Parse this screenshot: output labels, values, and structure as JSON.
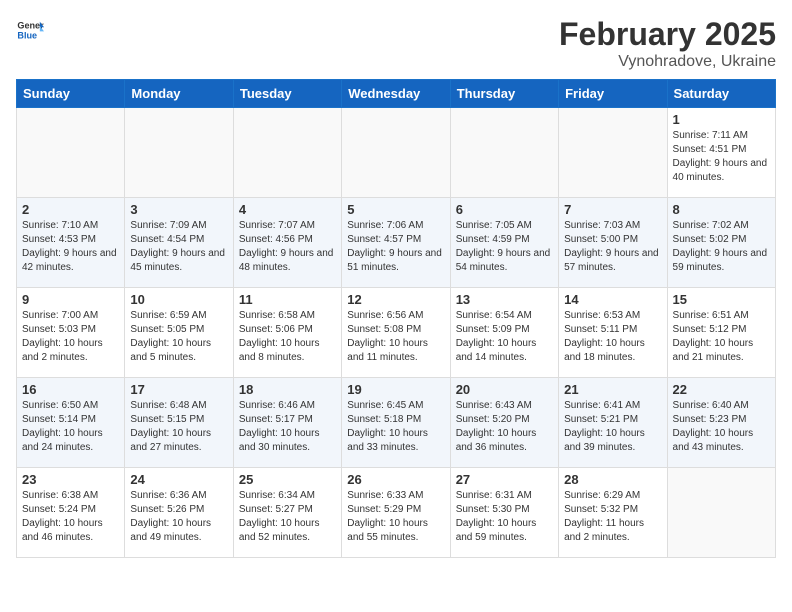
{
  "header": {
    "logo_general": "General",
    "logo_blue": "Blue",
    "month": "February 2025",
    "location": "Vynohradove, Ukraine"
  },
  "weekdays": [
    "Sunday",
    "Monday",
    "Tuesday",
    "Wednesday",
    "Thursday",
    "Friday",
    "Saturday"
  ],
  "weeks": [
    [
      {
        "day": "",
        "info": ""
      },
      {
        "day": "",
        "info": ""
      },
      {
        "day": "",
        "info": ""
      },
      {
        "day": "",
        "info": ""
      },
      {
        "day": "",
        "info": ""
      },
      {
        "day": "",
        "info": ""
      },
      {
        "day": "1",
        "info": "Sunrise: 7:11 AM\nSunset: 4:51 PM\nDaylight: 9 hours and 40 minutes."
      }
    ],
    [
      {
        "day": "2",
        "info": "Sunrise: 7:10 AM\nSunset: 4:53 PM\nDaylight: 9 hours and 42 minutes."
      },
      {
        "day": "3",
        "info": "Sunrise: 7:09 AM\nSunset: 4:54 PM\nDaylight: 9 hours and 45 minutes."
      },
      {
        "day": "4",
        "info": "Sunrise: 7:07 AM\nSunset: 4:56 PM\nDaylight: 9 hours and 48 minutes."
      },
      {
        "day": "5",
        "info": "Sunrise: 7:06 AM\nSunset: 4:57 PM\nDaylight: 9 hours and 51 minutes."
      },
      {
        "day": "6",
        "info": "Sunrise: 7:05 AM\nSunset: 4:59 PM\nDaylight: 9 hours and 54 minutes."
      },
      {
        "day": "7",
        "info": "Sunrise: 7:03 AM\nSunset: 5:00 PM\nDaylight: 9 hours and 57 minutes."
      },
      {
        "day": "8",
        "info": "Sunrise: 7:02 AM\nSunset: 5:02 PM\nDaylight: 9 hours and 59 minutes."
      }
    ],
    [
      {
        "day": "9",
        "info": "Sunrise: 7:00 AM\nSunset: 5:03 PM\nDaylight: 10 hours and 2 minutes."
      },
      {
        "day": "10",
        "info": "Sunrise: 6:59 AM\nSunset: 5:05 PM\nDaylight: 10 hours and 5 minutes."
      },
      {
        "day": "11",
        "info": "Sunrise: 6:58 AM\nSunset: 5:06 PM\nDaylight: 10 hours and 8 minutes."
      },
      {
        "day": "12",
        "info": "Sunrise: 6:56 AM\nSunset: 5:08 PM\nDaylight: 10 hours and 11 minutes."
      },
      {
        "day": "13",
        "info": "Sunrise: 6:54 AM\nSunset: 5:09 PM\nDaylight: 10 hours and 14 minutes."
      },
      {
        "day": "14",
        "info": "Sunrise: 6:53 AM\nSunset: 5:11 PM\nDaylight: 10 hours and 18 minutes."
      },
      {
        "day": "15",
        "info": "Sunrise: 6:51 AM\nSunset: 5:12 PM\nDaylight: 10 hours and 21 minutes."
      }
    ],
    [
      {
        "day": "16",
        "info": "Sunrise: 6:50 AM\nSunset: 5:14 PM\nDaylight: 10 hours and 24 minutes."
      },
      {
        "day": "17",
        "info": "Sunrise: 6:48 AM\nSunset: 5:15 PM\nDaylight: 10 hours and 27 minutes."
      },
      {
        "day": "18",
        "info": "Sunrise: 6:46 AM\nSunset: 5:17 PM\nDaylight: 10 hours and 30 minutes."
      },
      {
        "day": "19",
        "info": "Sunrise: 6:45 AM\nSunset: 5:18 PM\nDaylight: 10 hours and 33 minutes."
      },
      {
        "day": "20",
        "info": "Sunrise: 6:43 AM\nSunset: 5:20 PM\nDaylight: 10 hours and 36 minutes."
      },
      {
        "day": "21",
        "info": "Sunrise: 6:41 AM\nSunset: 5:21 PM\nDaylight: 10 hours and 39 minutes."
      },
      {
        "day": "22",
        "info": "Sunrise: 6:40 AM\nSunset: 5:23 PM\nDaylight: 10 hours and 43 minutes."
      }
    ],
    [
      {
        "day": "23",
        "info": "Sunrise: 6:38 AM\nSunset: 5:24 PM\nDaylight: 10 hours and 46 minutes."
      },
      {
        "day": "24",
        "info": "Sunrise: 6:36 AM\nSunset: 5:26 PM\nDaylight: 10 hours and 49 minutes."
      },
      {
        "day": "25",
        "info": "Sunrise: 6:34 AM\nSunset: 5:27 PM\nDaylight: 10 hours and 52 minutes."
      },
      {
        "day": "26",
        "info": "Sunrise: 6:33 AM\nSunset: 5:29 PM\nDaylight: 10 hours and 55 minutes."
      },
      {
        "day": "27",
        "info": "Sunrise: 6:31 AM\nSunset: 5:30 PM\nDaylight: 10 hours and 59 minutes."
      },
      {
        "day": "28",
        "info": "Sunrise: 6:29 AM\nSunset: 5:32 PM\nDaylight: 11 hours and 2 minutes."
      },
      {
        "day": "",
        "info": ""
      }
    ]
  ]
}
